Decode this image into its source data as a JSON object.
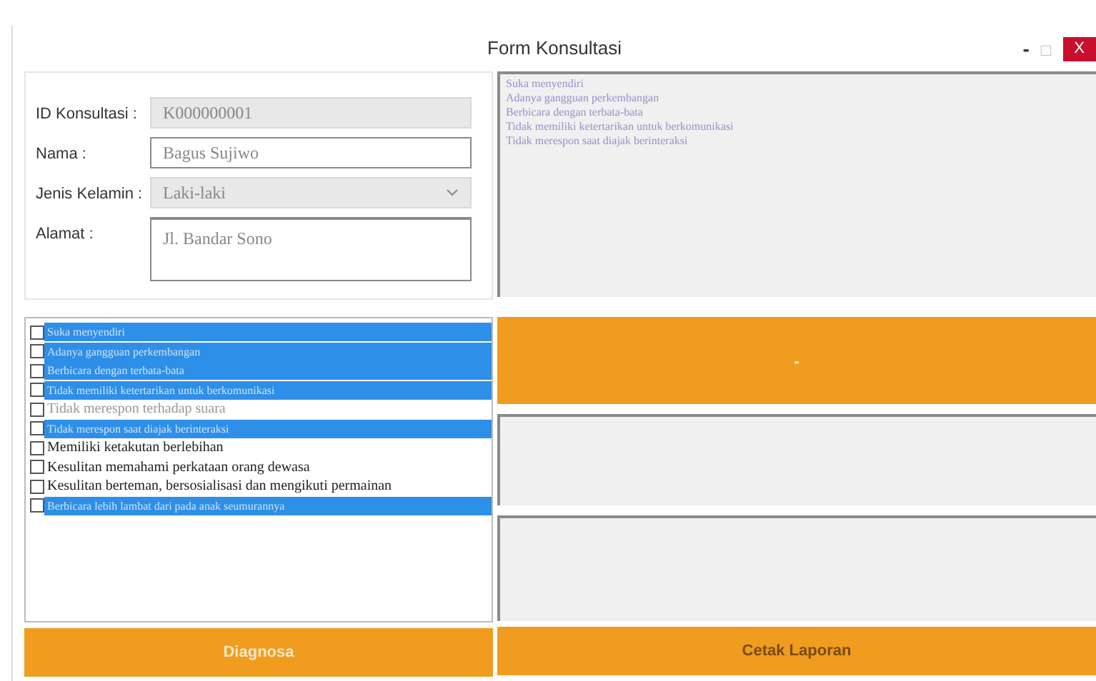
{
  "window": {
    "title": "Form Konsultasi",
    "controls": [
      "-",
      "□",
      "X"
    ]
  },
  "form": {
    "fields": [
      {
        "kind": "text",
        "label": "ID Konsultasi :",
        "value": "K000000001",
        "disabled": true
      },
      {
        "kind": "text",
        "label": "Nama :",
        "value": "Bagus Sujiwo",
        "disabled": false
      },
      {
        "kind": "select",
        "label": "Jenis Kelamin :",
        "value": "Laki-laki",
        "disabled": true
      },
      {
        "kind": "textarea",
        "label": "Alamat :",
        "value": "Jl. Bandar Sono",
        "disabled": false
      }
    ]
  },
  "summary_lines": [
    "Suka menyendiri",
    "Adanya gangguan perkembangan",
    "Berbicara dengan terbata-bata",
    "Tidak memiliki ketertarikan untuk berkomunikasi",
    "Tidak merespon saat diajak berinteraksi"
  ],
  "symptoms": [
    {
      "label": "Suka menyendiri",
      "checked": false,
      "selected": true,
      "disabled": false
    },
    {
      "label": "Adanya gangguan perkembangan",
      "checked": false,
      "selected": true,
      "disabled": false
    },
    {
      "label": "Berbicara dengan terbata-bata",
      "checked": false,
      "selected": true,
      "disabled": false
    },
    {
      "label": "Tidak memiliki ketertarikan untuk berkomunikasi",
      "checked": false,
      "selected": true,
      "disabled": false
    },
    {
      "label": "Tidak merespon terhadap suara",
      "checked": false,
      "selected": false,
      "disabled": true
    },
    {
      "label": "Tidak merespon saat diajak berinteraksi",
      "checked": false,
      "selected": true,
      "disabled": false
    },
    {
      "label": "Memiliki ketakutan berlebihan",
      "checked": false,
      "selected": false,
      "disabled": false
    },
    {
      "label": "Kesulitan memahami perkataan orang dewasa",
      "checked": false,
      "selected": false,
      "disabled": false
    },
    {
      "label": "Kesulitan berteman, bersosialisasi dan mengikuti permainan",
      "checked": false,
      "selected": false,
      "disabled": false
    },
    {
      "label": "Berbicara lebih lambat dari pada anak seumurannya",
      "checked": false,
      "selected": true,
      "disabled": false
    }
  ],
  "result": {
    "label": "-"
  },
  "buttons": {
    "diagnose": "Diagnosa",
    "print": "Cetak Laporan"
  }
}
